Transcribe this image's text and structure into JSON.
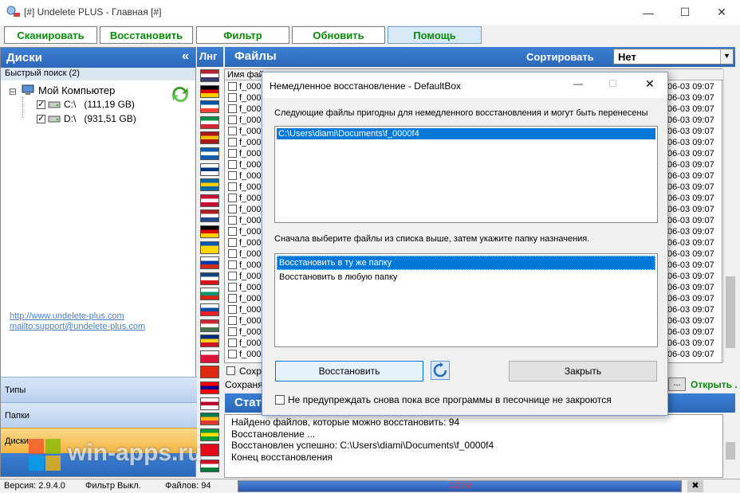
{
  "window": {
    "title": "[#] Undelete PLUS -  Главная [#]"
  },
  "toolbar": {
    "scan": "Сканировать",
    "restore": "Восстановить",
    "filter": "Фильтр",
    "refresh": "Обновить",
    "help": "Помощь"
  },
  "left": {
    "header": "Диски",
    "collapse": "«",
    "quick_search": "Быстрый поиск (2)",
    "tree_root": "Мой Компьютер",
    "drives": [
      {
        "label": "C:\\   (111,19 GB)"
      },
      {
        "label": "D:\\   (931,51 GB)"
      }
    ],
    "links": [
      "http://www.undelete-plus.com",
      "mailto:support@undelete-plus.com"
    ],
    "sections": [
      "Типы",
      "Папки",
      "Диски"
    ]
  },
  "lang_header": "Лнг",
  "files_header": "Файлы",
  "sort": {
    "label": "Сортировать",
    "value": "Нет"
  },
  "grid": {
    "col_name": "Имя файл",
    "col_date": "ен",
    "name_prefix": "f_000",
    "date": "06-03 09:07"
  },
  "save_checkbox": "Сохра",
  "save_label": "Сохранят",
  "browse": "...",
  "open": "Открыть .",
  "status_header": "Стат",
  "dialog": {
    "title": "Немедленное восстановление - DefaultBox",
    "intro": "Следующие файлы пригодны для немедленного восстановления и могут быть перенесены из песочницы:",
    "files": [
      "C:\\Users\\diami\\Documents\\f_0000f4"
    ],
    "choose_text": "Сначала выберите файлы из списка выше, затем укажите папку назначения.",
    "options": [
      "Восстановить в ту же папку",
      "Восстановить в любую папку"
    ],
    "restore_button": "Восстановить",
    "close_button": "Закрыть",
    "dont_warn": "Не предупреждать снова пока все программы в песочнице не закроются"
  },
  "log": [
    "Найдено файлов, которые можно восстановить: 94",
    "Восстановление ...",
    "Восстановлен успешно: C:\\Users\\diami\\Documents\\f_0000f4",
    "Конец восстановления"
  ],
  "status": {
    "version": "Версия: 2.9.4.0",
    "filter": "Фильтр Выкл.",
    "files": "Файлов: 94",
    "progress_text": "100%",
    "progress": 1.0
  },
  "watermark": "win-apps.ru",
  "flags": [
    [
      "#b22234",
      "#fff",
      "#3c3b6e"
    ],
    [
      "#000",
      "#dd0000",
      "#ffce00"
    ],
    [
      "#0055a4",
      "#fff",
      "#ef4135"
    ],
    [
      "#009246",
      "#fff",
      "#ce2b37"
    ],
    [
      "#aa151b",
      "#f1bf00",
      "#aa151b"
    ],
    [
      "#0d5eaf",
      "#fff",
      "#0d5eaf"
    ],
    [
      "#fff",
      "#003580",
      "#fff"
    ],
    [
      "#006aa7",
      "#fecc00",
      "#006aa7"
    ],
    [
      "#c60c30",
      "#fff",
      "#c60c30"
    ],
    [
      "#ae1c28",
      "#fff",
      "#21468b"
    ],
    [
      "#000",
      "#dd0000",
      "#ffce00"
    ],
    [
      "#0057b7",
      "#ffd700",
      "#ffd700"
    ],
    [
      "#fff",
      "#0039a6",
      "#d52b1e"
    ],
    [
      "#11457e",
      "#fff",
      "#d7141a"
    ],
    [
      "#fff",
      "#00966e",
      "#d62612"
    ],
    [
      "#fff",
      "#0b4ea2",
      "#ee1c25"
    ],
    [
      "#ce2939",
      "#fff",
      "#477050"
    ],
    [
      "#002b7f",
      "#fcd116",
      "#ce1126"
    ],
    [
      "#fff",
      "#dc143c",
      "#dc143c"
    ],
    [
      "#de2910",
      "#de2910",
      "#de2910"
    ],
    [
      "#fe0000",
      "#000095",
      "#fe0000"
    ],
    [
      "#fff",
      "#bc002d",
      "#fff"
    ],
    [
      "#007a4d",
      "#ffb612",
      "#de3831"
    ],
    [
      "#009c3b",
      "#ffdf00",
      "#009c3b"
    ],
    [
      "#e30a17",
      "#e30a17",
      "#e30a17"
    ],
    [
      "#ce1126",
      "#fff",
      "#007a3d"
    ]
  ],
  "colors": {
    "accent_green": "#0a8a0a",
    "header_blue": "#2c68b8",
    "selection": "#0078d7"
  }
}
